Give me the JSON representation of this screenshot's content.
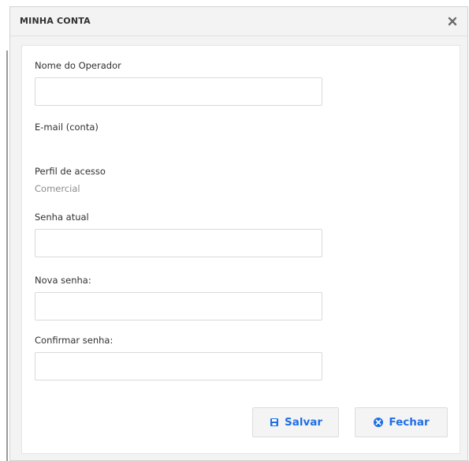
{
  "dialog": {
    "title": "MINHA CONTA",
    "close_icon": "close-x-icon"
  },
  "form": {
    "operator_name": {
      "label": "Nome do Operador",
      "value": "",
      "placeholder": ""
    },
    "email": {
      "label": "E-mail (conta)",
      "value": ""
    },
    "access_profile": {
      "label": "Perfil de acesso",
      "value": "Comercial"
    },
    "current_password": {
      "label": "Senha atual",
      "value": "",
      "placeholder": ""
    },
    "new_password": {
      "label": "Nova senha:",
      "value": "",
      "placeholder": ""
    },
    "confirm_password": {
      "label": "Confirmar senha:",
      "value": "",
      "placeholder": ""
    }
  },
  "actions": {
    "save_label": "Salvar",
    "save_icon": "save-icon",
    "close_label": "Fechar",
    "close_icon": "close-circle-icon"
  },
  "colors": {
    "accent": "#1f6fe6",
    "dialog_bg": "#f3f3f3",
    "content_bg": "#ffffff",
    "border": "#d9d9d9",
    "text": "#2f3032",
    "muted_text": "#8b8b8b"
  }
}
